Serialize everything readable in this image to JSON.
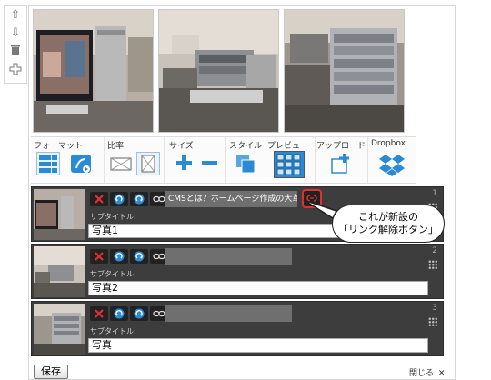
{
  "toolbar": {
    "format_label": "フォーマット",
    "ratio_label": "比率",
    "size_label": "サイズ",
    "style_label": "スタイル",
    "preview_label": "プレビュー",
    "upload_label": "アップロード",
    "dropbox_label": "Dropbox"
  },
  "rows": [
    {
      "index": "1",
      "title": "CMSとは？ホームページ作成の大革命！",
      "subtitle_label": "サブタイトル:",
      "subtitle_value": "写真1"
    },
    {
      "index": "2",
      "title": "",
      "subtitle_label": "サブタイトル:",
      "subtitle_value": "写真2"
    },
    {
      "index": "3",
      "title": "",
      "subtitle_label": "サブタイトル:",
      "subtitle_value": "写真"
    }
  ],
  "callout": {
    "line1": "これが新設の",
    "line2": "「リンク解除ボタン」"
  },
  "save_label": "保存",
  "close_label": "閉じる",
  "colors": {
    "accent_blue": "#2a8ad4",
    "delete_red": "#d52020",
    "row_bg": "#3d3d3d",
    "highlight_red": "#e03030"
  }
}
